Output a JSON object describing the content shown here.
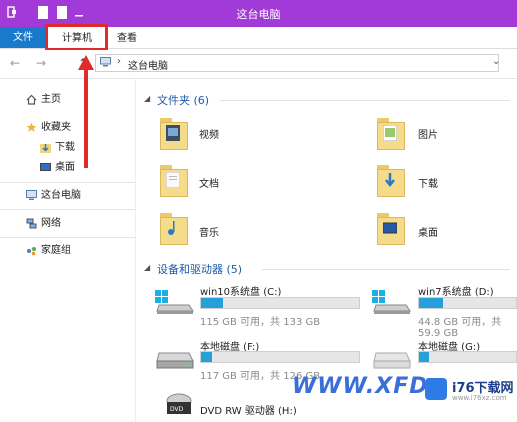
{
  "window": {
    "title": "这台电脑"
  },
  "ribbon": {
    "tab_file": "文件",
    "tab_computer": "计算机",
    "tab_view": "查看"
  },
  "address": {
    "path": "这台电脑",
    "separator": "›"
  },
  "nav": {
    "back": "←",
    "forward": "→",
    "up": "↑"
  },
  "sidebar": {
    "items": [
      {
        "label": "主页",
        "icon": "home-icon"
      },
      {
        "label": "收藏夹",
        "icon": "star-icon"
      },
      {
        "label": "下载",
        "icon": "download-icon"
      },
      {
        "label": "桌面",
        "icon": "desktop-icon"
      },
      {
        "label": "这台电脑",
        "icon": "computer-icon"
      },
      {
        "label": "网络",
        "icon": "network-icon"
      },
      {
        "label": "家庭组",
        "icon": "homegroup-icon"
      }
    ]
  },
  "folders_section": {
    "title": "文件夹 (6)"
  },
  "folders": [
    {
      "label": "视频",
      "icon": "video-folder-icon"
    },
    {
      "label": "图片",
      "icon": "pictures-folder-icon"
    },
    {
      "label": "文档",
      "icon": "documents-folder-icon"
    },
    {
      "label": "下载",
      "icon": "downloads-folder-icon"
    },
    {
      "label": "音乐",
      "icon": "music-folder-icon"
    },
    {
      "label": "桌面",
      "icon": "desktop-folder-icon"
    }
  ],
  "drives_section": {
    "title": "设备和驱动器 (5)"
  },
  "drives": [
    {
      "label": "win10系统盘 (C:)",
      "size": "115 GB 可用，共 133 GB",
      "used_fraction": 0.14,
      "icon": "windows-drive-icon"
    },
    {
      "label": "win7系统盘 (D:)",
      "size": "44.8 GB 可用，共 59.9 GB",
      "used_fraction": 0.25,
      "icon": "windows-drive-icon"
    },
    {
      "label": "本地磁盘 (F:)",
      "size": "117 GB 可用，共 126 GB",
      "used_fraction": 0.07,
      "icon": "hard-drive-icon"
    },
    {
      "label": "本地磁盘 (G:)",
      "size": "",
      "used_fraction": 0.1,
      "icon": "hard-drive-icon"
    },
    {
      "label": "DVD RW 驱动器 (H:)",
      "size": "",
      "icon": "dvd-drive-icon"
    }
  ],
  "watermark": {
    "text": "WWW.XFDO",
    "brand": "i76下载网",
    "url": "www.i76xz.com"
  },
  "colors": {
    "titlebar": "#a13ad6",
    "accent": "#1979ca",
    "highlight": "#e02b2b",
    "bar_fill": "#26a0da"
  }
}
